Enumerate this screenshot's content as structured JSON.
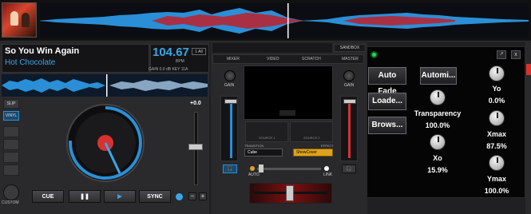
{
  "deck_left": {
    "title": "So You Win Again",
    "artist": "Hot Chocolate",
    "bpm_value": "104.67",
    "bpm_unit": "BPM",
    "tag": "1 All",
    "gain_line": "GAIN 0.0 dB   KEY 11A",
    "pitch": "+0.0",
    "side_buttons": [
      "SLIP",
      "VINYL"
    ],
    "custom_label": "CUSTOM",
    "transport": {
      "cue": "CUE",
      "pause": "❚❚",
      "play": "▶",
      "sync": "SYNC"
    },
    "minus": "−",
    "plus": "+"
  },
  "mixer": {
    "tabs": [
      "MIXER",
      "VIDEO",
      "SCRATCH",
      "MASTER"
    ],
    "sandbox": "SANDBOX",
    "gain_left": "GAIN",
    "gain_right": "GAIN",
    "source1": "SOURCE 1",
    "source2": "SOURCE 2",
    "transition_label": "TRANSITION",
    "effect_label": "EFFECT",
    "transition_value": "Cube",
    "effect_value": "ShowCover",
    "auto_label": "AUTO",
    "link_label": "LINK"
  },
  "plugin_panel": {
    "buttons": {
      "auto_fade": "Auto Fade",
      "automi": "Automi...",
      "loade": "Loade...",
      "brows": "Brows..."
    },
    "params": {
      "transparency_label": "Transparency",
      "transparency_value": "100.0%",
      "xo_label": "Xo",
      "xo_value": "15.9%",
      "yo_label": "Yo",
      "yo_value": "0.0%",
      "xmax_label": "Xmax",
      "xmax_value": "87.5%",
      "ymax_label": "Ymax",
      "ymax_value": "100.0%"
    },
    "pin_icon": "pin-icon",
    "close_icon": "close-icon",
    "close_glyph": "x",
    "pin_glyph": "↗"
  },
  "colors": {
    "accent_blue": "#39a6e8",
    "accent_red": "#d8322e",
    "effect_yellow": "#e0a21a",
    "led_green": "#1fdc4a"
  }
}
